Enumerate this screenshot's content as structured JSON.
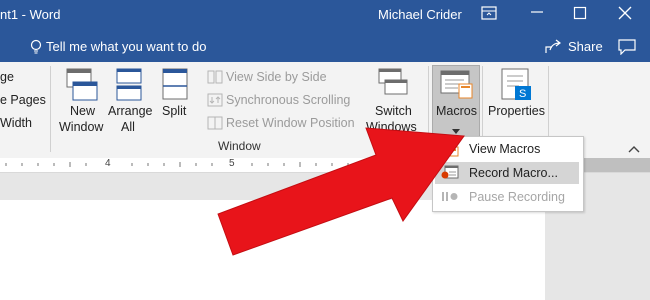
{
  "titlebar": {
    "doc_title": "nt1 - Word",
    "user": "Michael Crider",
    "controls": [
      "ribbon-display-icon",
      "minimize-icon",
      "maximize-icon",
      "close-icon"
    ]
  },
  "tellbar": {
    "tell_me": "Tell me what you want to do",
    "share": "Share",
    "comments_icon": "comment-icon"
  },
  "ribbon": {
    "left_partial": [
      "ge",
      "e Pages",
      "Width"
    ],
    "new_window": [
      "New",
      "Window"
    ],
    "arrange_all": [
      "Arrange",
      "All"
    ],
    "split": "Split",
    "view_side_by_side": "View Side by Side",
    "sync_scrolling": "Synchronous Scrolling",
    "reset_window_position": "Reset Window Position",
    "switch_windows": [
      "Switch",
      "Windows"
    ],
    "macros": "Macros",
    "properties": "Properties",
    "group_window": "Window",
    "collapse_icon": "chevron-up-icon"
  },
  "ruler": {
    "ticks": [
      "4",
      "5"
    ]
  },
  "macros_menu": {
    "items": [
      {
        "label": "View Macros",
        "icon": "view-macros-icon",
        "enabled": true,
        "highlighted": false
      },
      {
        "label": "Record Macro...",
        "icon": "record-macro-icon",
        "enabled": true,
        "highlighted": true
      },
      {
        "label": "Pause Recording",
        "icon": "pause-icon",
        "enabled": false,
        "highlighted": false
      }
    ]
  },
  "colors": {
    "title_blue": "#2b579a",
    "ribbon_bg": "#f3f3f3",
    "arrow_red": "#e8141a",
    "accent_orange": "#e8862a"
  }
}
